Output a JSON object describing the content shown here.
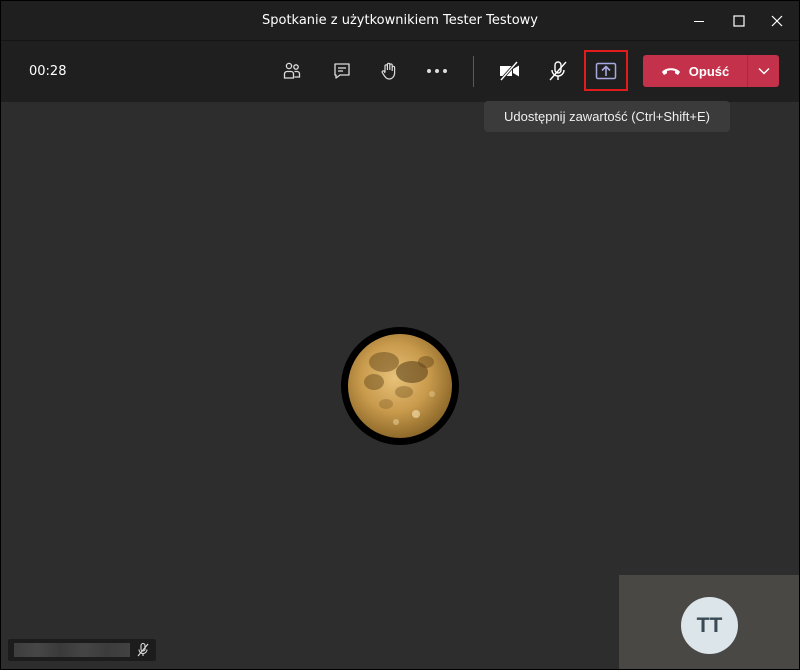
{
  "window": {
    "title": "Spotkanie z użytkownikiem Tester Testowy"
  },
  "toolbar": {
    "timer": "00:28",
    "leave_label": "Opuść"
  },
  "tooltip": {
    "text": "Udostępnij zawartość (Ctrl+Shift+E)"
  },
  "self_view": {
    "initials": "TT"
  },
  "colors": {
    "leave_red": "#c4314b",
    "highlight_red": "#e01c1c",
    "stage_bg": "#2d2d2d",
    "bar_bg": "#1f1f1f",
    "share_icon": "#a7a8e0"
  },
  "icons": {
    "participants": "people-icon",
    "chat": "chat-icon",
    "raise_hand": "hand-icon",
    "more": "more-icon",
    "camera": "camera-off-icon",
    "mic": "mic-off-icon",
    "share": "share-tray-icon",
    "leave": "phone-hangup-icon"
  }
}
